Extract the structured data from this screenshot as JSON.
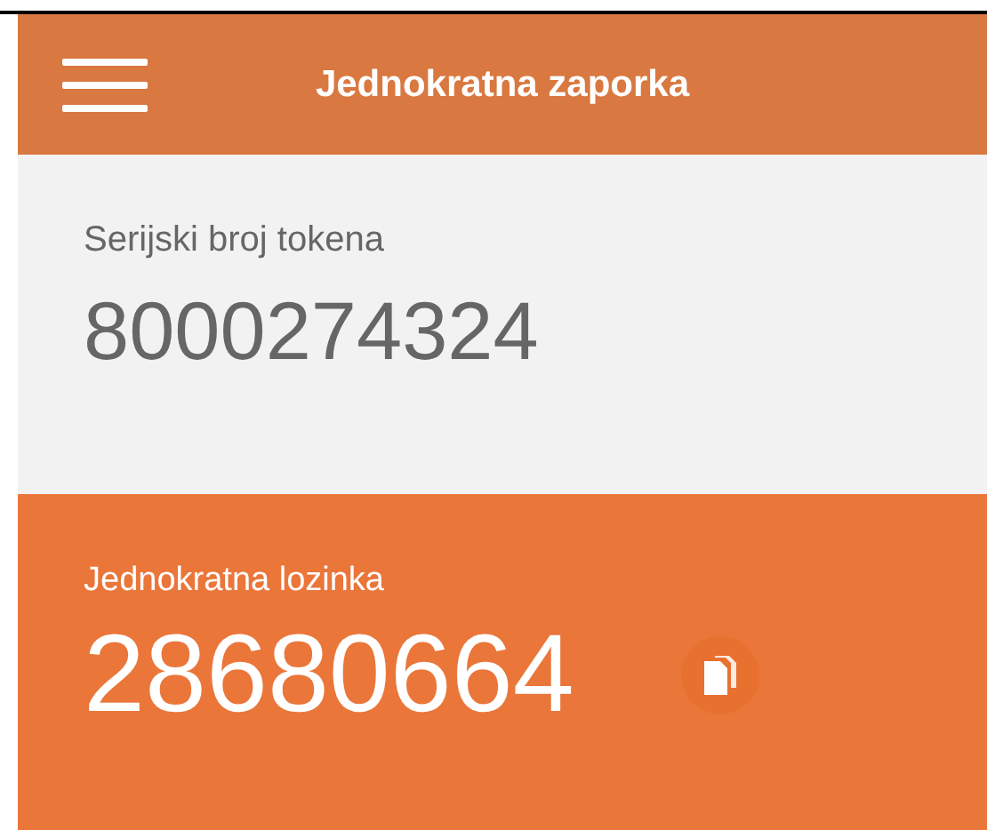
{
  "header": {
    "title": "Jednokratna zaporka"
  },
  "token": {
    "label": "Serijski broj tokena",
    "value": "8000274324"
  },
  "otp": {
    "label": "Jednokratna lozinka",
    "value": "28680664"
  }
}
